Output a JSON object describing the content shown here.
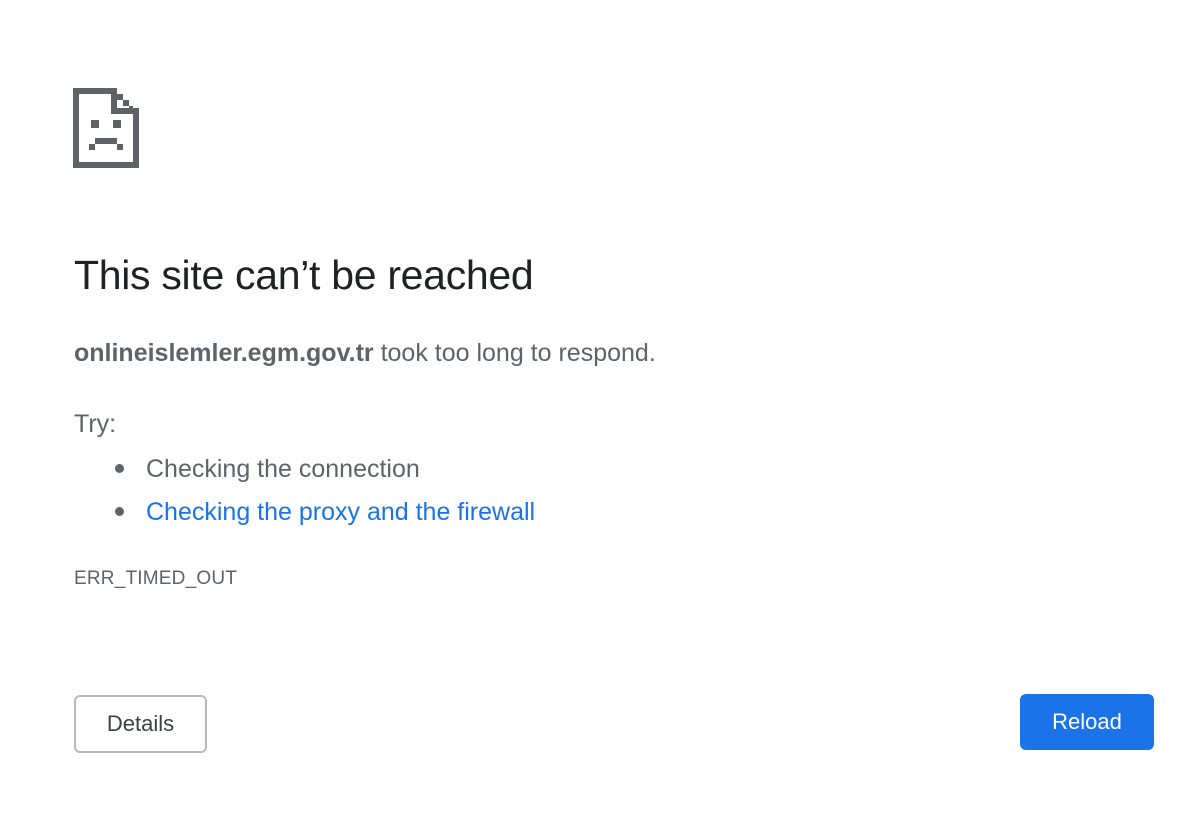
{
  "icon": "sad-document-icon",
  "title": "This site can’t be reached",
  "summary": {
    "host": "onlineislemler.egm.gov.tr",
    "message": " took too long to respond."
  },
  "try_label": "Try:",
  "suggestions": [
    {
      "label": "Checking the connection",
      "is_link": false
    },
    {
      "label": "Checking the proxy and the firewall",
      "is_link": true
    }
  ],
  "error_code": "ERR_TIMED_OUT",
  "buttons": {
    "details_label": "Details",
    "reload_label": "Reload"
  },
  "colors": {
    "text_primary": "#202124",
    "text_secondary": "#5f6368",
    "link": "#1a73e8",
    "reload_button": "#1a73e8"
  }
}
